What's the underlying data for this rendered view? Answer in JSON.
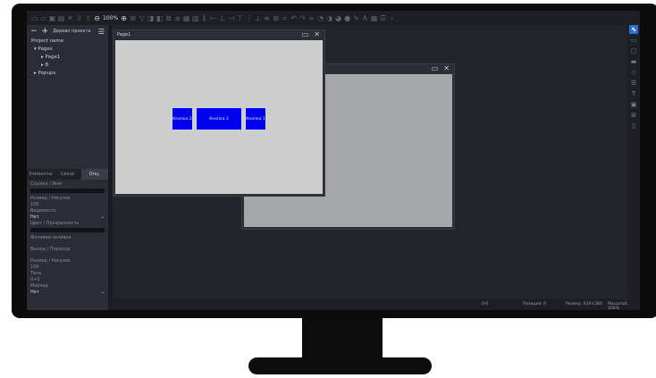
{
  "toolbar": {
    "zoom_label": "100%",
    "icons": [
      "new-file-icon",
      "open-folder-icon",
      "save-icon",
      "save-as-icon",
      "close-icon",
      "export-icon",
      "import-icon",
      "zoom-out-icon",
      "zoom-in-icon",
      "align-icon"
    ]
  },
  "left_panel": {
    "minus_label": "−",
    "plus_label": "+",
    "header_title": "Дерево проекта",
    "tree": {
      "root": "Project name",
      "pages_label": "Pages",
      "page1": "Page1",
      "page2": "B",
      "popups_label": "Popups"
    },
    "tabs": [
      "Элементы",
      "Связи",
      "Опц."
    ],
    "props": {
      "label1": "Ссылка / Имя",
      "label2": "Размер / Рисунок",
      "label2_value": "100",
      "label3": "Видимость",
      "select1": "Нет",
      "label4": "Цвет / Прозрачность",
      "label5": "Фоновая заливка",
      "label6": "Выход / Переход",
      "label7": "Размер / Рисунок",
      "label7_value": "100",
      "label8": "Тень",
      "label8_value": "0+0",
      "label9": "Маркер",
      "select2": "Нет"
    }
  },
  "windows": {
    "front_title": "Page1",
    "back_title": ""
  },
  "buttons": [
    {
      "label": "Кнопка 2"
    },
    {
      "label": "Кнопка 3"
    },
    {
      "label": "Кнопка 1"
    }
  ],
  "status_bar": {
    "coords": "0:0",
    "position": "Позиция: 0",
    "size": "Размер: 610×380",
    "zoom": "Масштаб: 100%"
  },
  "colors": {
    "accent": "#2a72d8",
    "button_fill": "#0000f0"
  }
}
